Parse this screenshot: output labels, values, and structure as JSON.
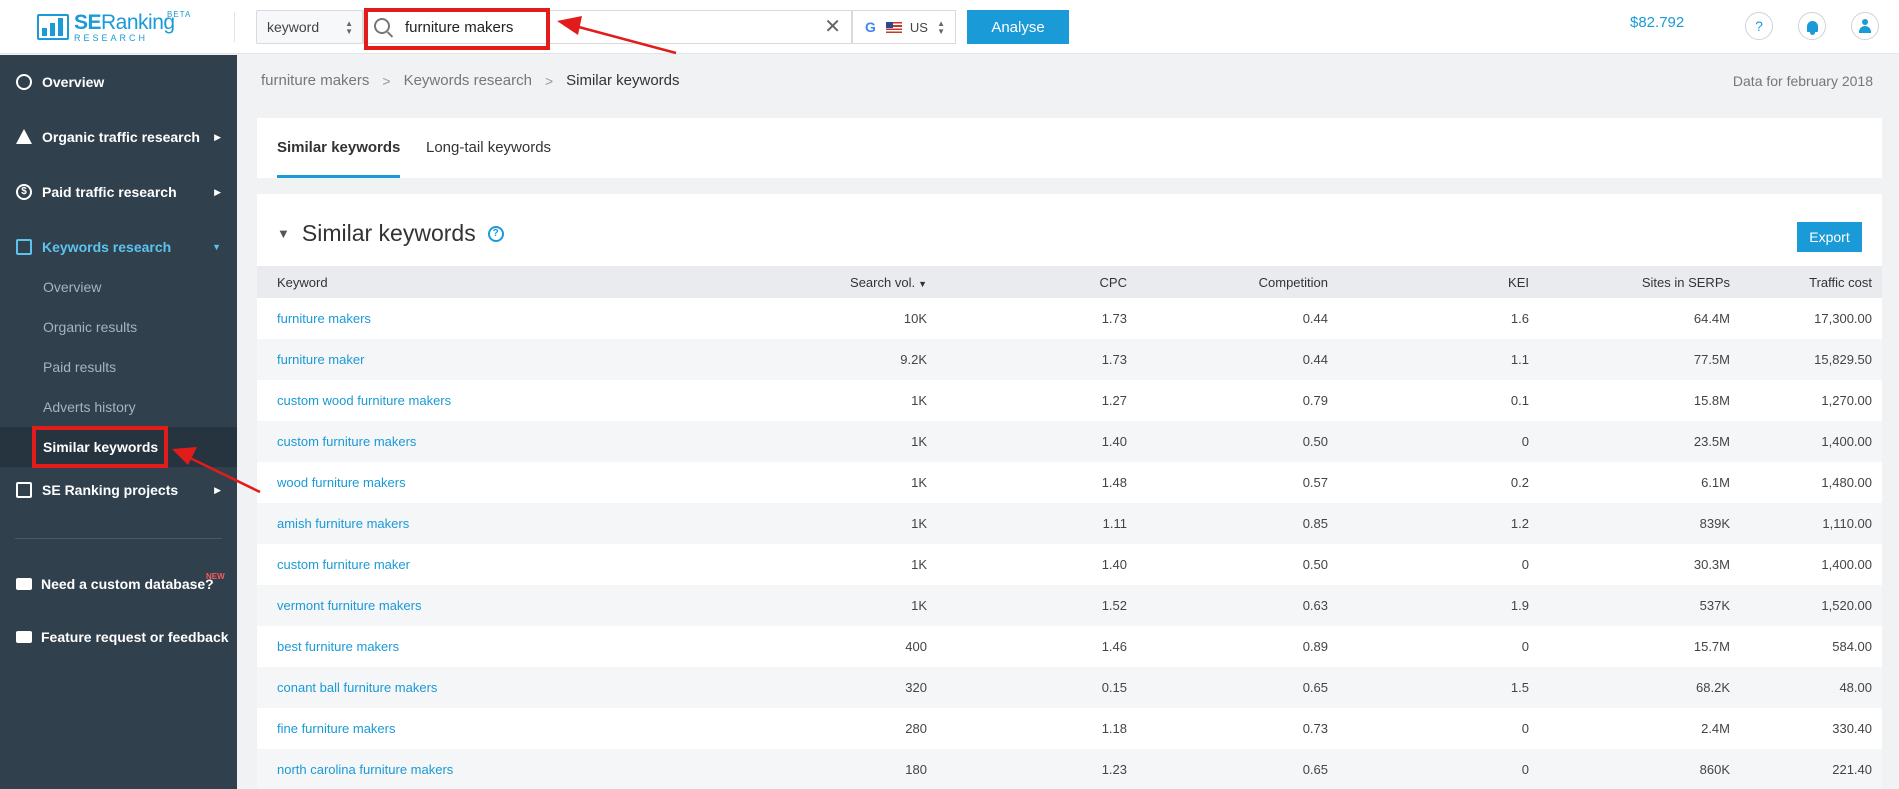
{
  "header": {
    "logo": {
      "se": "SE",
      "ranking": "Ranking",
      "sub": "RESEARCH",
      "beta": "BETA"
    },
    "search_type": "keyword",
    "search_query": "furniture makers",
    "region": "US",
    "search_engine_icon": "google-icon",
    "analyse_label": "Analyse",
    "balance": "$82.792",
    "help_label": "?"
  },
  "sidebar": {
    "items": [
      {
        "label": "Overview",
        "icon": "overview-icon"
      },
      {
        "label": "Organic traffic research",
        "icon": "triangle-icon"
      },
      {
        "label": "Paid traffic research",
        "icon": "dollar-icon"
      },
      {
        "label": "Keywords research",
        "icon": "keywords-icon"
      }
    ],
    "sub_items": [
      {
        "label": "Overview"
      },
      {
        "label": "Organic results"
      },
      {
        "label": "Paid results"
      },
      {
        "label": "Adverts history"
      },
      {
        "label": "Similar keywords"
      }
    ],
    "projects": {
      "label": "SE Ranking projects",
      "icon": "chart-icon"
    },
    "footer": [
      {
        "label": "Need a custom database?",
        "badge": "NEW",
        "icon": "database-icon"
      },
      {
        "label": "Feature request or feedback",
        "icon": "chat-icon"
      }
    ]
  },
  "breadcrumb": {
    "items": [
      "furniture makers",
      "Keywords research",
      "Similar keywords"
    ]
  },
  "data_date": "Data for february 2018",
  "tabs": [
    {
      "label": "Similar keywords"
    },
    {
      "label": "Long-tail keywords"
    }
  ],
  "section": {
    "title": "Similar keywords",
    "export_label": "Export"
  },
  "table": {
    "columns": [
      "Keyword",
      "Search vol.",
      "CPC",
      "Competition",
      "KEI",
      "Sites in SERPs",
      "Traffic cost"
    ],
    "rows": [
      [
        "furniture makers",
        "10K",
        "1.73",
        "0.44",
        "1.6",
        "64.4M",
        "17,300.00"
      ],
      [
        "furniture maker",
        "9.2K",
        "1.73",
        "0.44",
        "1.1",
        "77.5M",
        "15,829.50"
      ],
      [
        "custom wood furniture makers",
        "1K",
        "1.27",
        "0.79",
        "0.1",
        "15.8M",
        "1,270.00"
      ],
      [
        "custom furniture makers",
        "1K",
        "1.40",
        "0.50",
        "0",
        "23.5M",
        "1,400.00"
      ],
      [
        "wood furniture makers",
        "1K",
        "1.48",
        "0.57",
        "0.2",
        "6.1M",
        "1,480.00"
      ],
      [
        "amish furniture makers",
        "1K",
        "1.11",
        "0.85",
        "1.2",
        "839K",
        "1,110.00"
      ],
      [
        "custom furniture maker",
        "1K",
        "1.40",
        "0.50",
        "0",
        "30.3M",
        "1,400.00"
      ],
      [
        "vermont furniture makers",
        "1K",
        "1.52",
        "0.63",
        "1.9",
        "537K",
        "1,520.00"
      ],
      [
        "best furniture makers",
        "400",
        "1.46",
        "0.89",
        "0",
        "15.7M",
        "584.00"
      ],
      [
        "conant ball furniture makers",
        "320",
        "0.15",
        "0.65",
        "1.5",
        "68.2K",
        "48.00"
      ],
      [
        "fine furniture makers",
        "280",
        "1.18",
        "0.73",
        "0",
        "2.4M",
        "330.40"
      ],
      [
        "north carolina furniture makers",
        "180",
        "1.23",
        "0.65",
        "0",
        "860K",
        "221.40"
      ]
    ]
  },
  "colors": {
    "accent": "#1a9ad6",
    "sidebar_bg": "#30404d",
    "highlight": "#e21b1b"
  }
}
